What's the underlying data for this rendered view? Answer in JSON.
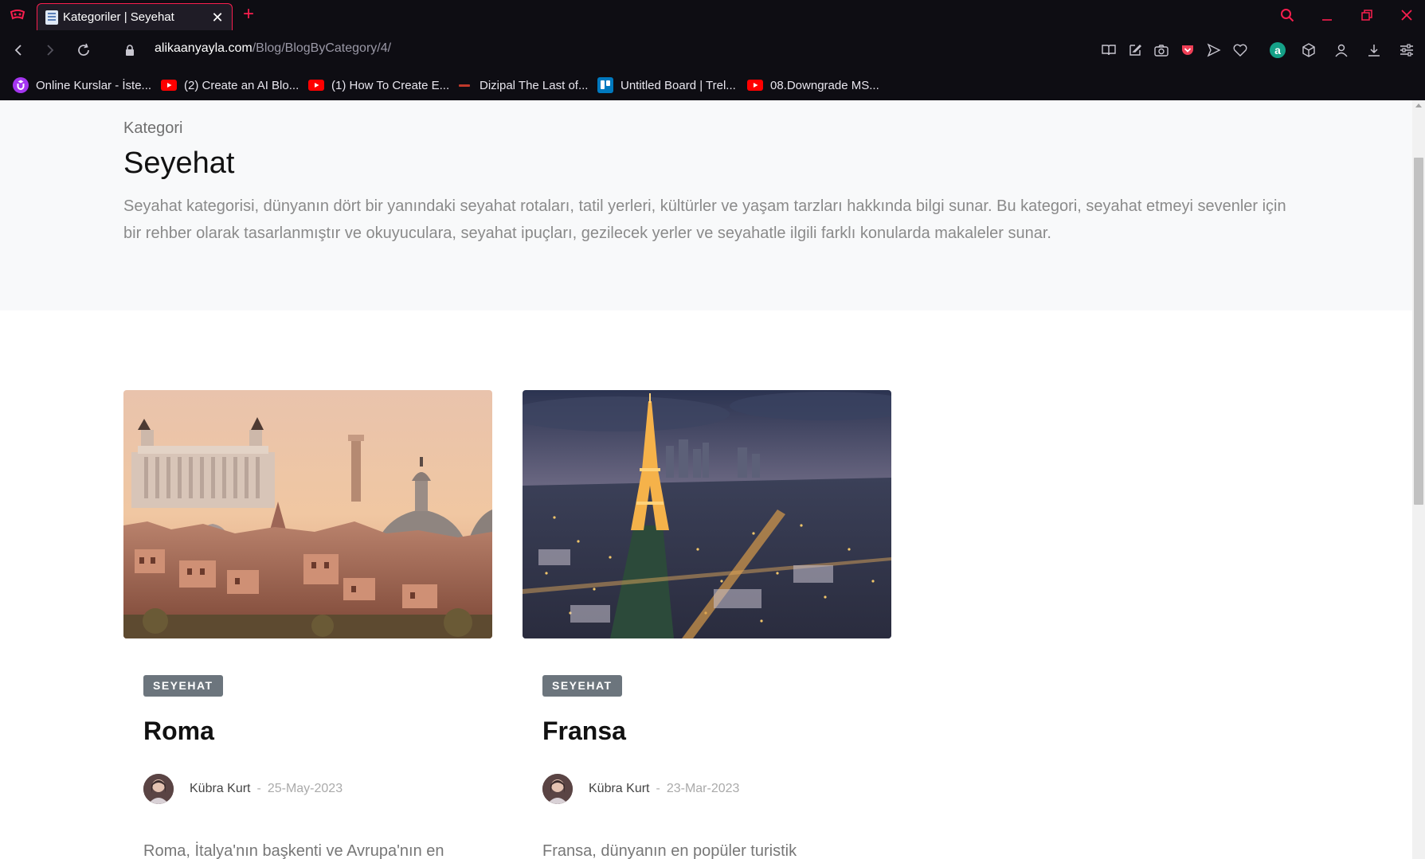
{
  "browser": {
    "tab_title": "Kategoriler | Seyehat",
    "new_tab_label": "+",
    "url_domain": "alikaanyayla.com",
    "url_path": "/Blog/BlogByCategory/4/",
    "bookmarks": [
      {
        "label": "Online Kurslar - İste...",
        "icon": "udemy-icon",
        "color": "#a435f0"
      },
      {
        "label": "(2) Create an AI Blo...",
        "icon": "youtube-icon",
        "color": "#ff0000"
      },
      {
        "label": "(1) How To Create E...",
        "icon": "youtube-icon",
        "color": "#ff0000"
      },
      {
        "label": "Dizipal The Last of...",
        "icon": "dizipal-icon",
        "color": "#c0392b"
      },
      {
        "label": "Untitled Board | Trel...",
        "icon": "trello-icon",
        "color": "#0079bf"
      },
      {
        "label": "08.Downgrade MS...",
        "icon": "youtube-icon",
        "color": "#ff0000"
      }
    ],
    "accent_color": "#fa1e4e"
  },
  "hero": {
    "kicker": "Kategori",
    "title": "Seyehat",
    "description": "Seyahat kategorisi, dünyanın dört bir yanındaki seyahat rotaları, tatil yerleri, kültürler ve yaşam tarzları hakkında bilgi sunar. Bu kategori, seyahat etmeyi sevenler için bir rehber olarak tasarlanmıştır ve okuyuculara, seyahat ipuçları, gezilecek yerler ve seyahatle ilgili farklı konularda makaleler sunar."
  },
  "posts": [
    {
      "category": "SEYEHAT",
      "title": "Roma",
      "author": "Kübra Kurt",
      "separator": "-",
      "date": "25-May-2023",
      "excerpt": "Roma, İtalya'nın başkenti ve Avrupa'nın en"
    },
    {
      "category": "SEYEHAT",
      "title": "Fransa",
      "author": "Kübra Kurt",
      "separator": "-",
      "date": "23-Mar-2023",
      "excerpt": "Fransa, dünyanın en popüler turistik"
    }
  ]
}
